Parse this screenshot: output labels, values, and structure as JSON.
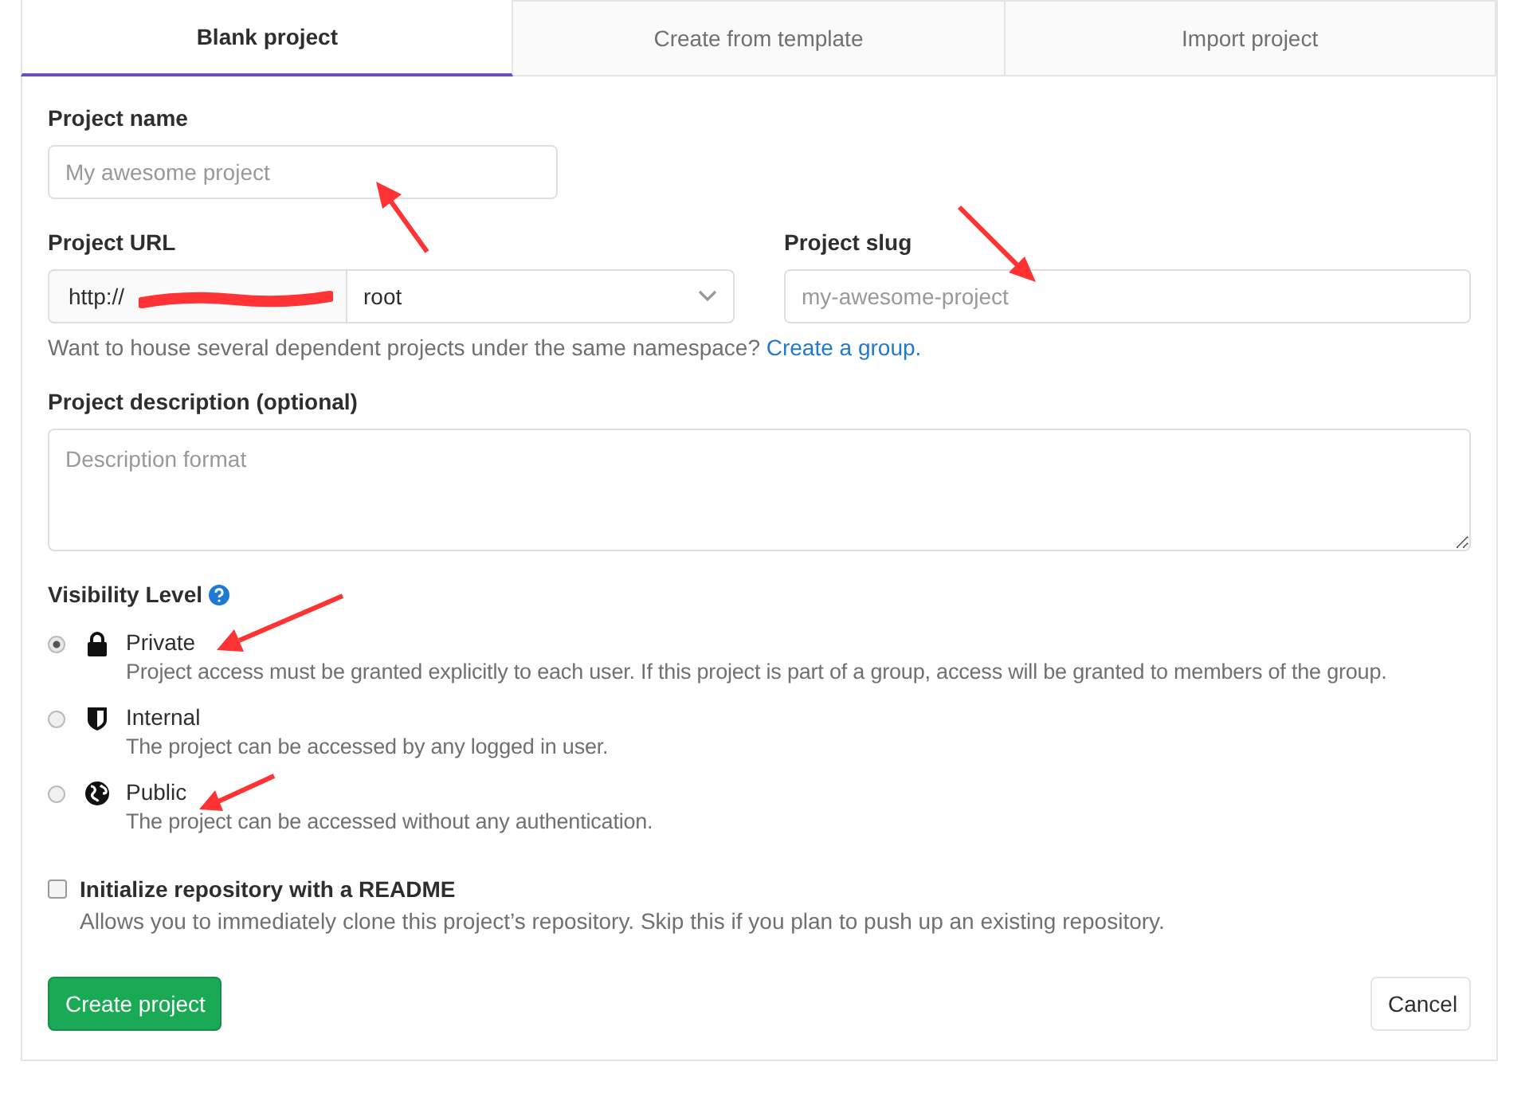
{
  "tabs": [
    {
      "label": "Blank project",
      "selected": true
    },
    {
      "label": "Create from template",
      "selected": false
    },
    {
      "label": "Import project",
      "selected": false
    }
  ],
  "project_name": {
    "label": "Project name",
    "placeholder": "My awesome project"
  },
  "project_url": {
    "label": "Project URL",
    "prefix": "http://",
    "namespace": "root"
  },
  "project_slug": {
    "label": "Project slug",
    "placeholder": "my-awesome-project"
  },
  "namespace_hint": {
    "text": "Want to house several dependent projects under the same namespace?",
    "link": "Create a group."
  },
  "description": {
    "label": "Project description (optional)",
    "placeholder": "Description format"
  },
  "visibility": {
    "label": "Visibility Level",
    "options": [
      {
        "kind": "lock",
        "label": "Private",
        "description": "Project access must be granted explicitly to each user. If this project is part of a group, access will be granted to members of the group.",
        "selected": true
      },
      {
        "kind": "shield",
        "label": "Internal",
        "description": "The project can be accessed by any logged in user.",
        "selected": false
      },
      {
        "kind": "globe",
        "label": "Public",
        "description": "The project can be accessed without any authentication.",
        "selected": false
      }
    ]
  },
  "readme": {
    "label": "Initialize repository with a README",
    "description": "Allows you to immediately clone this project’s repository. Skip this if you plan to push up an existing repository.",
    "checked": false
  },
  "buttons": {
    "create": "Create project",
    "cancel": "Cancel"
  }
}
